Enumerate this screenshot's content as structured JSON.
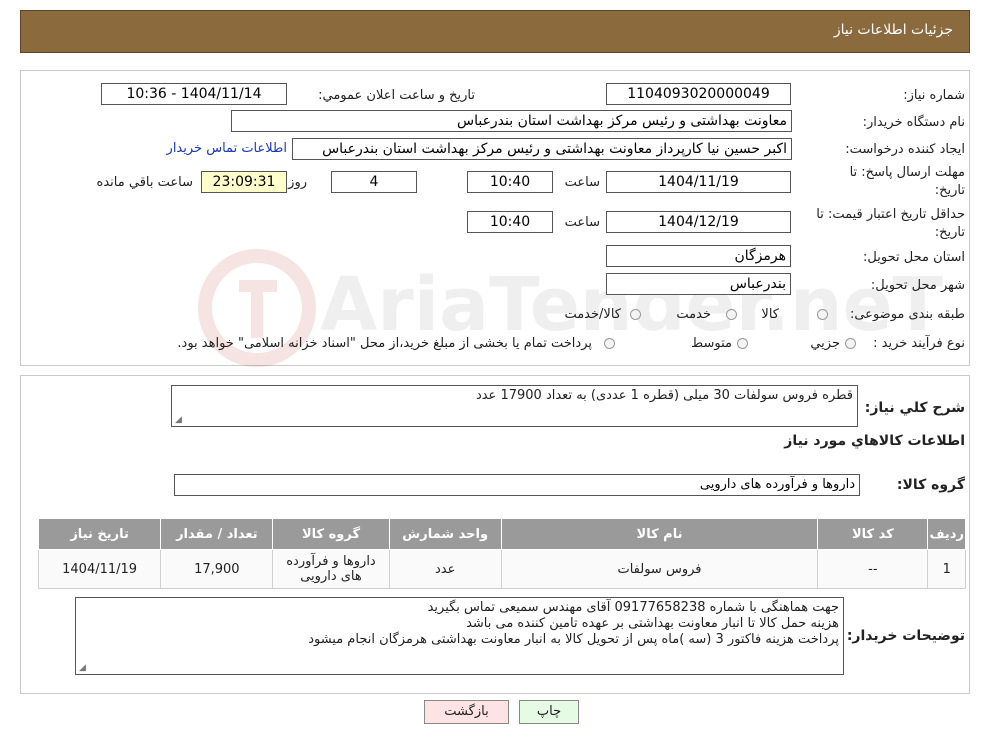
{
  "header": {
    "title": "جزئيات اطلاعات نياز"
  },
  "form": {
    "need_number_label": "شماره نیاز:",
    "need_number": "1104093020000049",
    "announce_label": "تاريخ و ساعت اعلان عمومي:",
    "announce_value": "1404/11/14 - 10:36",
    "buyer_org_label": "نام دستگاه خريدار:",
    "buyer_org": "معاونت  بهداشتی و رئیس مرکز بهداشت استان بندرعباس",
    "creator_label": "ايجاد کننده درخواست:",
    "creator": "اکبر حسین نیا کارپرداز معاونت  بهداشتی و رئیس مرکز بهداشت استان بندرعباس",
    "contact_link": "اطلاعات تماس خريدار",
    "deadline_label_1": "مهلت ارسال پاسخ: تا",
    "deadline_label_2": "تاريخ:",
    "deadline_date": "1404/11/19",
    "time_label": "ساعت",
    "deadline_time": "10:40",
    "days_value": "4",
    "days_label": "روز و",
    "remaining_time": "23:09:31",
    "remaining_label": "ساعت باقي مانده",
    "validity_label_1": "حداقل تاريخ اعتبار قيمت: تا",
    "validity_label_2": "تاريخ:",
    "validity_date": "1404/12/19",
    "validity_time": "10:40",
    "province_label": "استان محل تحويل:",
    "province": "هرمزگان",
    "city_label": "شهر محل تحويل:",
    "city": "بندرعباس",
    "category_label": "طبقه بندی موضوعی:",
    "category_options": [
      "کالا",
      "خدمت",
      "کالا/خدمت"
    ],
    "process_label": "نوع فرآيند خريد :",
    "process_options": [
      "جزيي",
      "متوسط"
    ],
    "process_note": "پرداخت تمام يا بخشی از مبلغ خريد،از محل \"اسناد خزانه اسلامی\" خواهد بود."
  },
  "summary": {
    "label": "شرح کلي نياز:",
    "text": "قطره فروس سولفات 30 میلی (قطره 1 عددی) به تعداد 17900 عدد"
  },
  "goods": {
    "section_title": "اطلاعات کالاهاي مورد نياز",
    "group_label": "گروه کالا:",
    "group_value": "داروها و فرآورده های دارويی",
    "columns": [
      "رديف",
      "کد کالا",
      "نام کالا",
      "واحد شمارش",
      "گروه کالا",
      "تعداد / مقدار",
      "تاريخ نياز"
    ],
    "rows": [
      [
        "1",
        "--",
        "فروس سولفات",
        "عدد",
        "داروها و فرآورده های دارويی",
        "17,900",
        "1404/11/19"
      ]
    ]
  },
  "buyer_notes": {
    "label": "توضيحات خريدار:",
    "lines": [
      "جهت هماهنگی با شماره 09177658238 آقای مهندس سمیعی تماس بگیرید",
      "هزینه حمل کالا تا انبار  معاونت بهداشتی بر عهده تامین کننده می باشد",
      "پرداخت هزینه فاکتور 3 (سه )ماه  پس از تحویل کالا به انبار معاونت بهداشتی هرمزگان انجام میشود"
    ]
  },
  "buttons": {
    "print": "چاپ",
    "back": "بازگشت"
  },
  "colors": {
    "header_bg": "#8b6b3e",
    "print_bg": "#e6fbe3",
    "back_bg": "#fde3e3",
    "highlight_bg": "#ffffcc"
  },
  "watermark": {
    "text": "AriaTender.neT"
  }
}
